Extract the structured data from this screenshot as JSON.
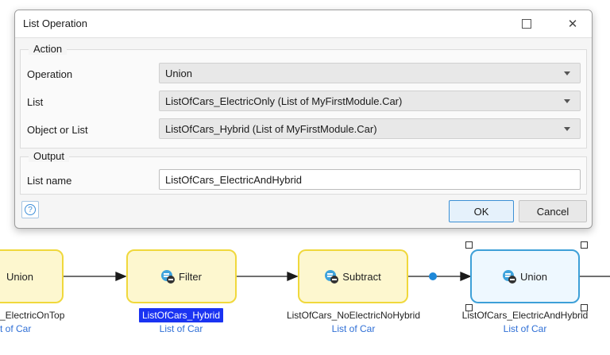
{
  "dialog": {
    "title": "List Operation",
    "action_legend": "Action",
    "fields": {
      "operation": {
        "label": "Operation",
        "value": "Union"
      },
      "list": {
        "label": "List",
        "value": "ListOfCars_ElectricOnly (List of MyFirstModule.Car)"
      },
      "object_or_list": {
        "label": "Object or List",
        "value": "ListOfCars_Hybrid (List of MyFirstModule.Car)"
      }
    },
    "output_legend": "Output",
    "list_name": {
      "label": "List name",
      "value": "ListOfCars_ElectricAndHybrid"
    },
    "ok_label": "OK",
    "cancel_label": "Cancel",
    "help_glyph": "?",
    "close_glyph": "✕"
  },
  "flow": {
    "nodes": [
      {
        "label": "Union",
        "caption": "_ElectricOnTop",
        "type": "t of Car",
        "icon": "list-operation-icon"
      },
      {
        "label": "Filter",
        "caption": "ListOfCars_Hybrid",
        "type": "List of Car",
        "icon": "list-operation-icon"
      },
      {
        "label": "Subtract",
        "caption": "ListOfCars_NoElectricNoHybrid",
        "type": "List of Car",
        "icon": "list-operation-icon"
      },
      {
        "label": "Union",
        "caption": "ListOfCars_ElectricAndHybrid",
        "type": "List of Car",
        "icon": "list-operation-icon"
      }
    ],
    "colors": {
      "node_fill": "#fdf7cf",
      "node_border": "#f0d83c",
      "selected_border": "#3ea0d8",
      "caption_highlight": "#1a33f2",
      "type_text": "#2f6fd6"
    }
  }
}
